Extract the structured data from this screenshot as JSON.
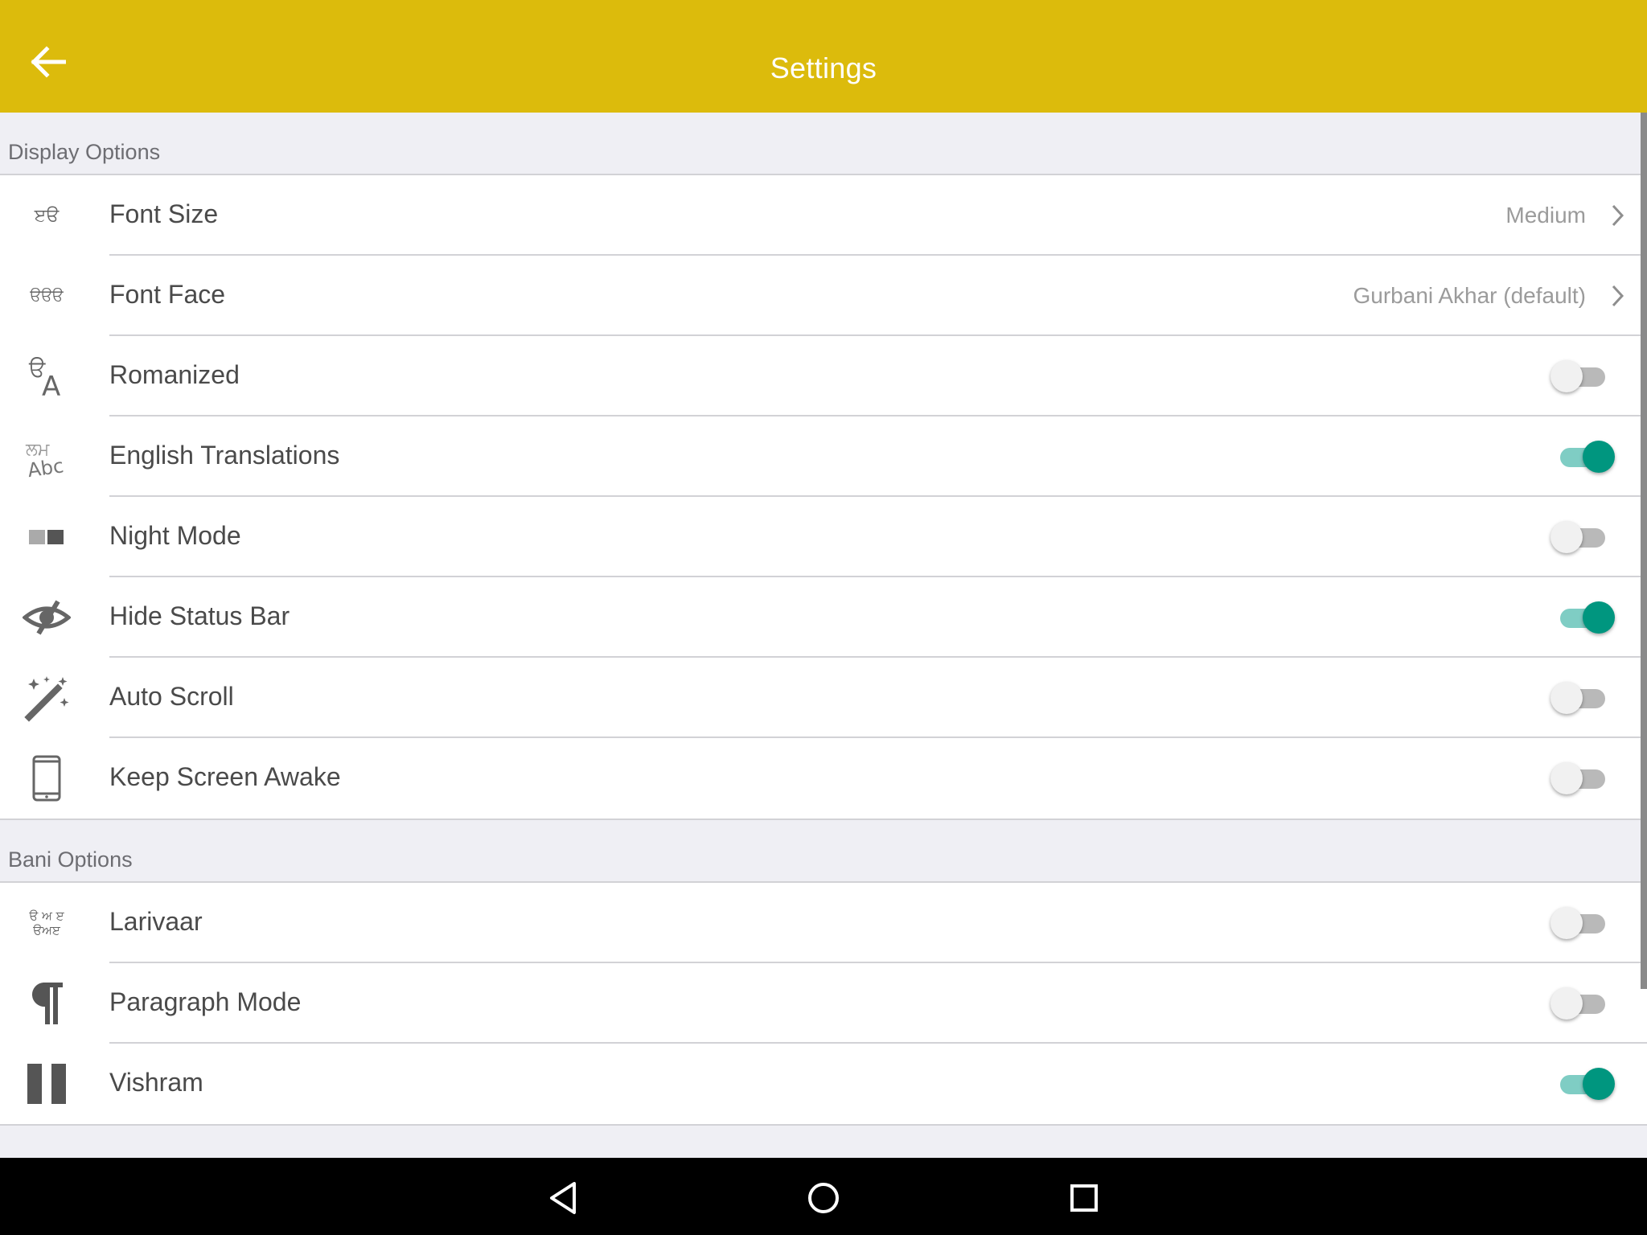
{
  "header": {
    "title": "Settings",
    "back_icon": "arrow-left-icon",
    "background_color": "#dcbb0c"
  },
  "sections": [
    {
      "title": "Display Options",
      "items": [
        {
          "label": "Font Size",
          "icon": "font-size-icon",
          "type": "select",
          "value": "Medium"
        },
        {
          "label": "Font Face",
          "icon": "font-face-icon",
          "type": "select",
          "value": "Gurbani Akhar (default)"
        },
        {
          "label": "Romanized",
          "icon": "romanized-icon",
          "type": "toggle",
          "enabled": false
        },
        {
          "label": "English Translations",
          "icon": "translation-icon",
          "type": "toggle",
          "enabled": true
        },
        {
          "label": "Night Mode",
          "icon": "night-mode-icon",
          "type": "toggle",
          "enabled": false
        },
        {
          "label": "Hide Status Bar",
          "icon": "eye-slash-icon",
          "type": "toggle",
          "enabled": true
        },
        {
          "label": "Auto Scroll",
          "icon": "magic-wand-icon",
          "type": "toggle",
          "enabled": false
        },
        {
          "label": "Keep Screen Awake",
          "icon": "phone-icon",
          "type": "toggle",
          "enabled": false
        }
      ]
    },
    {
      "title": "Bani Options",
      "items": [
        {
          "label": "Larivaar",
          "icon": "larivaar-icon",
          "type": "toggle",
          "enabled": false
        },
        {
          "label": "Paragraph Mode",
          "icon": "pilcrow-icon",
          "type": "toggle",
          "enabled": false
        },
        {
          "label": "Vishram",
          "icon": "pause-icon",
          "type": "toggle",
          "enabled": true
        }
      ]
    }
  ],
  "icon_glyphs": {
    "font-size-icon": "ੲੳ",
    "font-face-icon": "ੳੳੳ",
    "larivaar-top": "ੳ ਅ ੲ",
    "larivaar-bottom": "ੳਅੲ"
  },
  "colors": {
    "toggle_on_knob": "#00967f",
    "toggle_on_track": "#7fcdc4",
    "toggle_off_knob": "#f1f1f1",
    "toggle_off_track": "#b9b9b9"
  },
  "navigation_bar": {
    "buttons": [
      "back-nav-icon",
      "home-nav-icon",
      "recents-nav-icon"
    ]
  }
}
